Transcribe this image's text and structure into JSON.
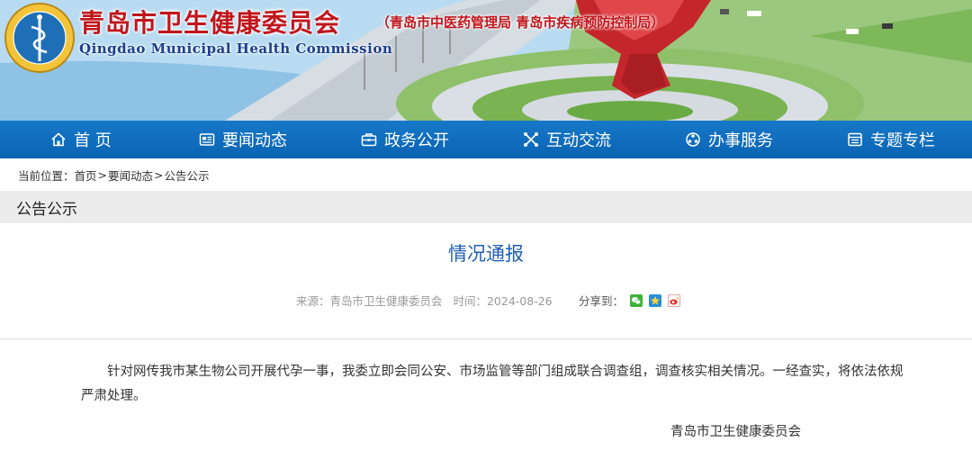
{
  "header": {
    "title_cn": "青岛市卫生健康委员会",
    "subtitle_cn": "（青岛市中医药管理局 青岛市疾病预防控制局）",
    "title_en": "Qingdao Municipal Health Commission",
    "logo_icon": "health-emblem-icon"
  },
  "nav": {
    "items": [
      {
        "label": "首 页",
        "icon": "home-icon"
      },
      {
        "label": "要闻动态",
        "icon": "news-icon"
      },
      {
        "label": "政务公开",
        "icon": "briefcase-icon"
      },
      {
        "label": "互动交流",
        "icon": "interaction-icon"
      },
      {
        "label": "办事服务",
        "icon": "service-icon"
      },
      {
        "label": "专题专栏",
        "icon": "column-icon"
      }
    ]
  },
  "breadcrumb": {
    "prefix": "当前位置：",
    "items": [
      "首页",
      "要闻动态",
      "公告公示"
    ],
    "separator": ">"
  },
  "section": {
    "title": "公告公示"
  },
  "article": {
    "title": "情况通报",
    "source_label": "来源：",
    "source": "青岛市卫生健康委员会",
    "time_label": "时间：",
    "date": "2024-08-26",
    "share_label": "分享到：",
    "share_icons": [
      "wechat-icon",
      "qzone-icon",
      "weibo-icon"
    ],
    "body": "针对网传我市某生物公司开展代孕一事，我委立即会同公安、市场监管等部门组成联合调查组，调查核实相关情况。一经查实，将依法依规严肃处理。",
    "signature": "青岛市卫生健康委员会"
  },
  "colors": {
    "nav_bg": "#0a63b3",
    "title_red": "#c0161c",
    "title_blue": "#1c3f8a",
    "article_title": "#1f5fb0"
  }
}
